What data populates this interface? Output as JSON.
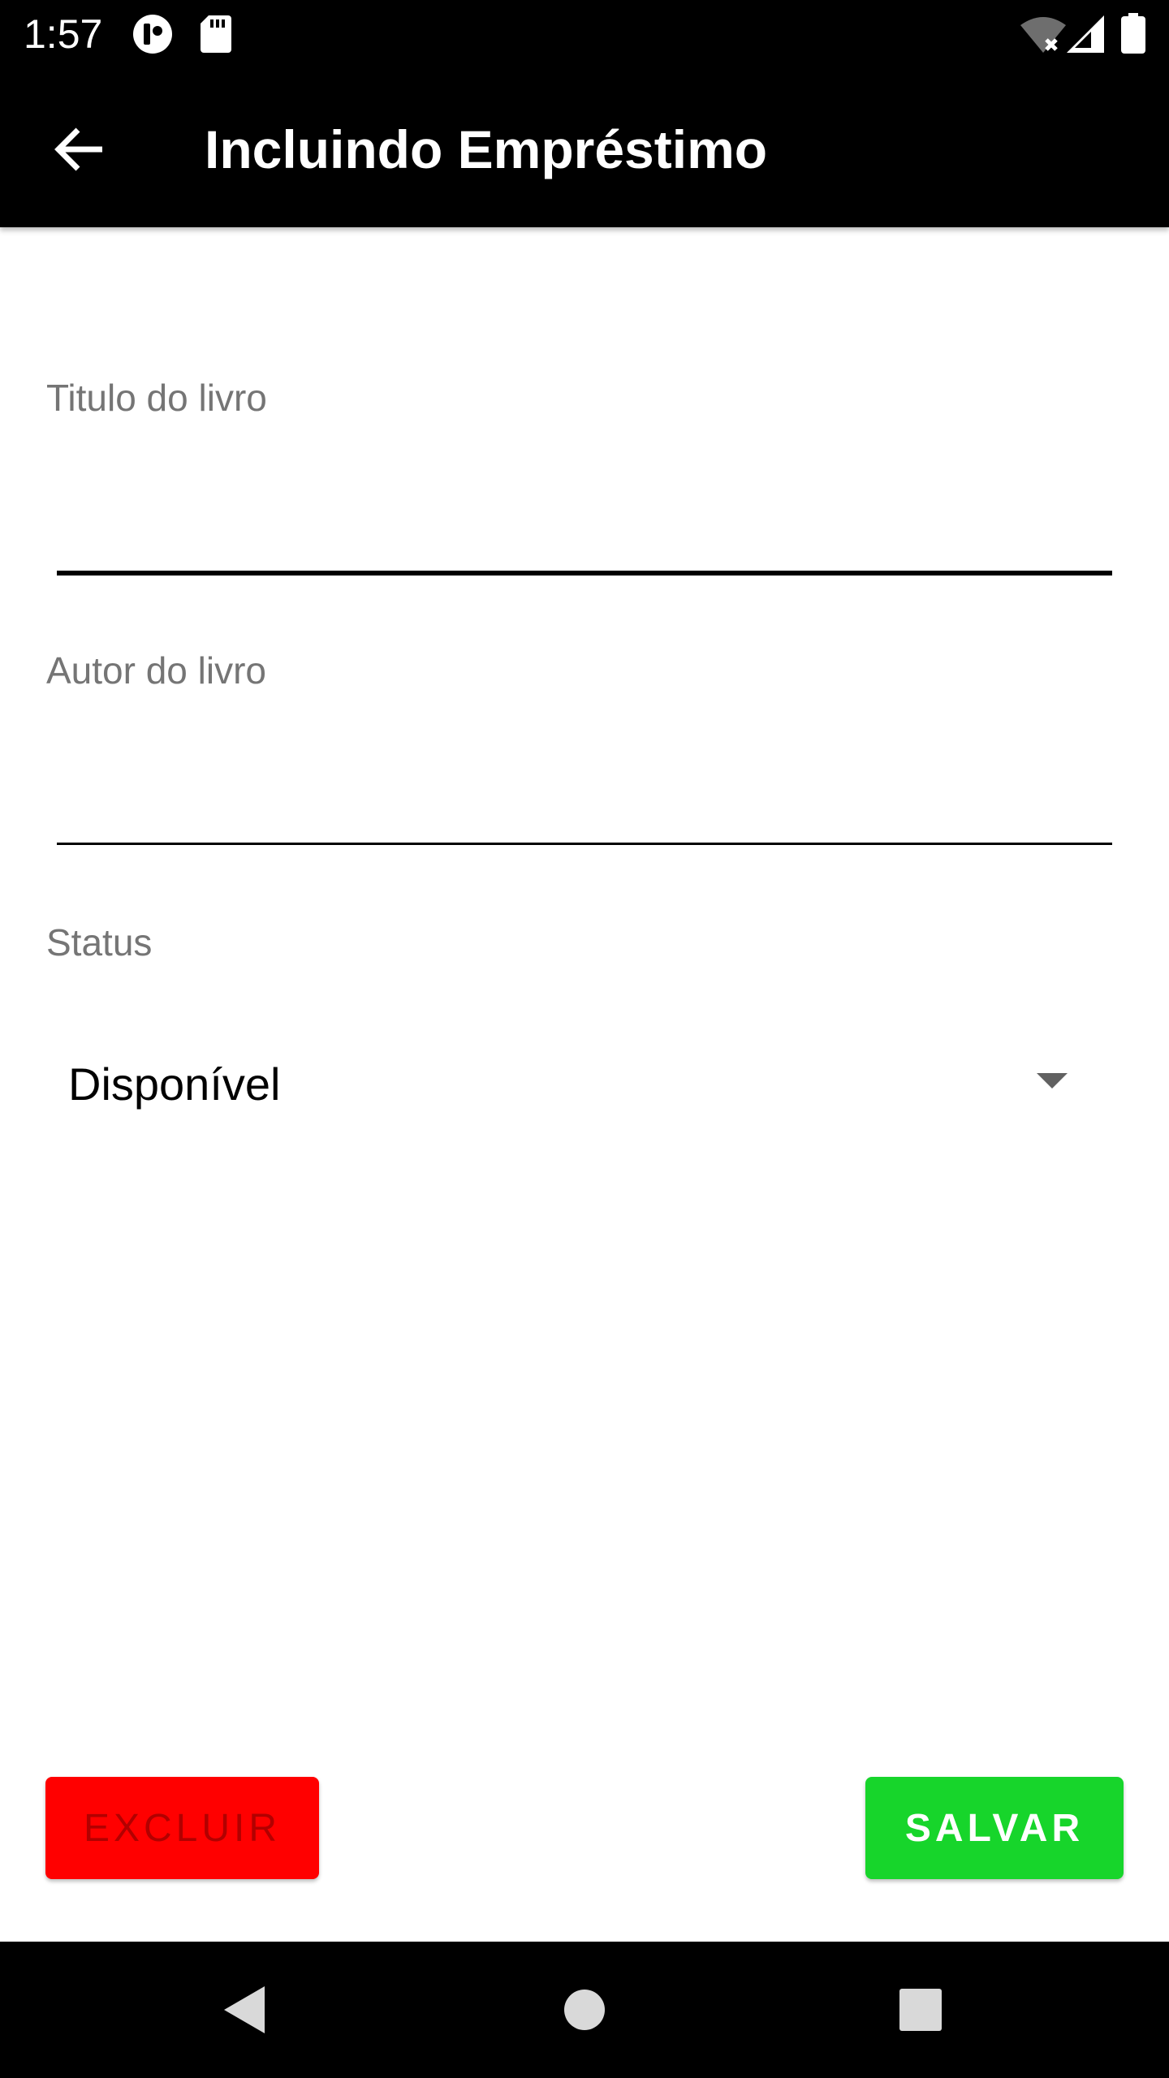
{
  "status_bar": {
    "time": "1:57",
    "icons": [
      "circle-app-icon",
      "sd-card-icon",
      "wifi-off-icon",
      "signal-icon",
      "battery-icon"
    ]
  },
  "app_bar": {
    "title": "Incluindo Empréstimo",
    "back_icon": "arrow-back-icon"
  },
  "form": {
    "title_field": {
      "label": "Titulo do livro",
      "value": ""
    },
    "author_field": {
      "label": "Autor do livro",
      "value": ""
    },
    "status_field": {
      "label": "Status",
      "selected": "Disponível"
    }
  },
  "buttons": {
    "delete_label": "EXCLUIR",
    "save_label": "SALVAR"
  },
  "nav_bar": {
    "icons": [
      "back-triangle-icon",
      "home-circle-icon",
      "recents-square-icon"
    ]
  },
  "colors": {
    "app_bar": "#000000",
    "delete_button": "#ff0000",
    "delete_text": "#b20000",
    "save_button": "#17d52b",
    "label": "#757575"
  }
}
